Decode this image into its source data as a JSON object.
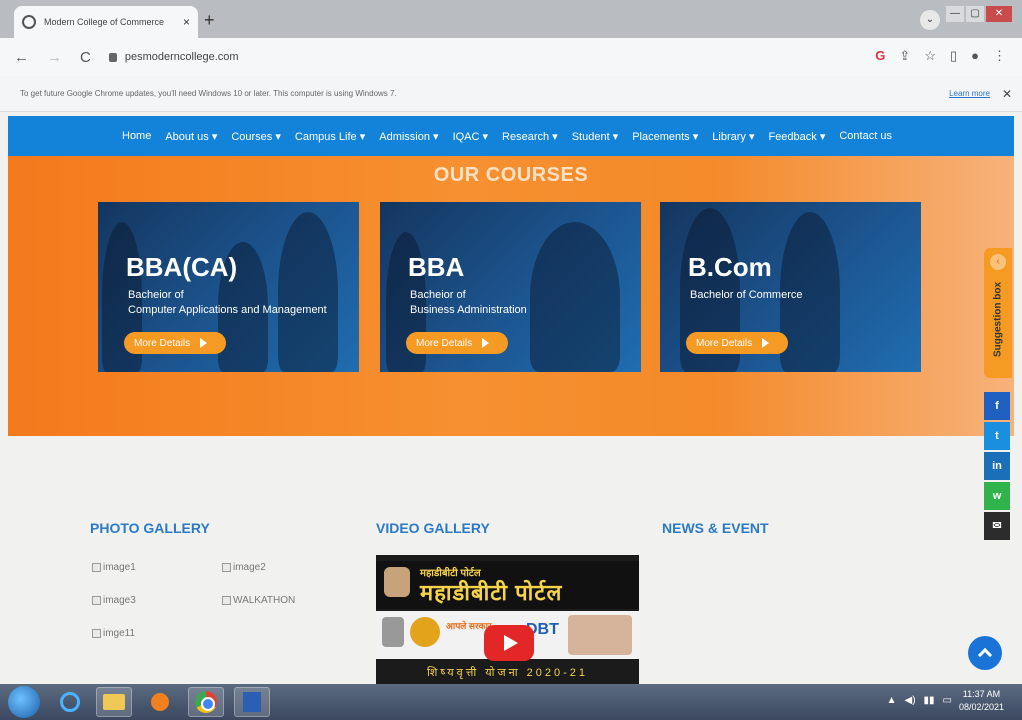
{
  "browser": {
    "tab_title": "Modern College of Commerce",
    "new_tab": "+",
    "tab_close": "×",
    "tab_menu": "⌄",
    "url": "pesmoderncollege.com",
    "back": "←",
    "forward": "→",
    "reload": "C",
    "win_min": "—",
    "win_max": "▢",
    "win_close": "✕",
    "toolbar_g": "G",
    "toolbar_share": "⇪",
    "toolbar_star": "☆",
    "toolbar_sidebar": "▯",
    "toolbar_profile": "●",
    "toolbar_menu": "⋮",
    "infobar_text": "To get future Google Chrome updates, you'll need Windows 10 or later. This computer is using Windows 7.",
    "infobar_learn": "Learn more",
    "infobar_close": "✕"
  },
  "nav": {
    "items": [
      {
        "label": "Home"
      },
      {
        "label": "About us ▾"
      },
      {
        "label": "Courses ▾"
      },
      {
        "label": "Campus Life ▾"
      },
      {
        "label": "Admission ▾"
      },
      {
        "label": "IQAC ▾"
      },
      {
        "label": "Research ▾"
      },
      {
        "label": "Student ▾"
      },
      {
        "label": "Placements ▾"
      },
      {
        "label": "Library ▾"
      },
      {
        "label": "Feedback ▾"
      },
      {
        "label": "Contact us"
      }
    ]
  },
  "courses": {
    "title": "OUR COURSES",
    "cards": [
      {
        "name": "BBA(CA)",
        "line1": "Bacheior of",
        "line2": "Computer Applications and Management",
        "more": "More Details"
      },
      {
        "name": "BBA",
        "line1": "Bacheior of",
        "line2": "Business Administration",
        "more": "More Details"
      },
      {
        "name": "B.Com",
        "line1": "Bachelor of Commerce",
        "line2": "",
        "more": "More Details"
      }
    ]
  },
  "widgets": {
    "suggestion": "Suggestion box",
    "suggestion_arrow": "‹",
    "social": [
      {
        "label": "f",
        "color": "#1f5fbf"
      },
      {
        "label": "t",
        "color": "#1a8fe0"
      },
      {
        "label": "in",
        "color": "#1a6fb8"
      },
      {
        "label": "w",
        "color": "#2fb34a"
      },
      {
        "label": "✉",
        "color": "#2c2c2c"
      }
    ]
  },
  "photo_gallery": {
    "title": "PHOTO GALLERY",
    "images": [
      "image1",
      "image2",
      "image3",
      "WALKATHON",
      "imge11"
    ]
  },
  "video_gallery": {
    "title": "VIDEO GALLERY",
    "hindi_small": "महाडीबीटी पोर्टल",
    "hindi_big": "महाडीबीटी पोर्टल",
    "dbt": "DBT",
    "logo_text": "आपले सरकार",
    "bottom_text": "शिष्यवृत्ती योजना 2020-21"
  },
  "news": {
    "title": "NEWS & EVENT"
  },
  "taskbar": {
    "time": "11:37 AM",
    "date": "08/02/2021",
    "tray": [
      "▲",
      "◀)",
      "▮▮",
      "▭"
    ]
  }
}
